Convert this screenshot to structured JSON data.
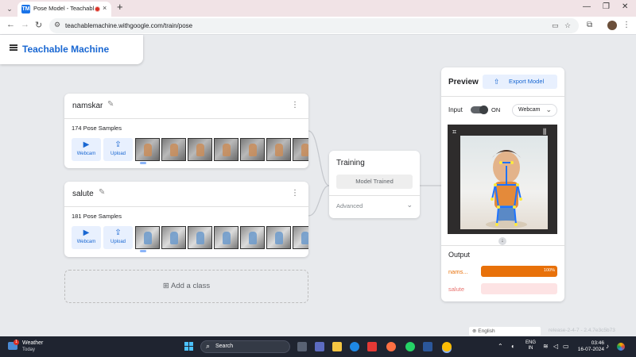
{
  "browser": {
    "tab_title": "Pose Model - Teachable Mac",
    "tab_close": "×",
    "new_tab": "+",
    "url": "teachablemachine.withgoogle.com/train/pose"
  },
  "app": {
    "title": "Teachable Machine"
  },
  "classes": [
    {
      "name": "namskar",
      "samples": "174 Pose Samples",
      "webcam_label": "Webcam",
      "upload_label": "Upload"
    },
    {
      "name": "salute",
      "samples": "181 Pose Samples",
      "webcam_label": "Webcam",
      "upload_label": "Upload"
    }
  ],
  "add_class": {
    "label": "Add a class"
  },
  "training": {
    "title": "Training",
    "button": "Model Trained",
    "advanced": "Advanced"
  },
  "preview": {
    "title": "Preview",
    "export_label": "Export Model",
    "input_label": "Input",
    "input_state": "ON",
    "source": "Webcam",
    "output_title": "Output",
    "outputs": [
      {
        "label": "nams...",
        "value": 100,
        "value_label": "100%",
        "color": "#e8710a",
        "track": "#fce8d6"
      },
      {
        "label": "salute",
        "value": 0,
        "value_label": "",
        "color": "#e8716d",
        "track": "#fde3e4"
      }
    ]
  },
  "footer": {
    "language": "English",
    "version": "release-2-4-7 - 2.4.7e3c5b73"
  },
  "taskbar": {
    "weather_badge": "1",
    "weather_title": "Weather",
    "weather_sub": "Today",
    "search_placeholder": "Search",
    "lang_top": "ENG",
    "lang_bottom": "IN",
    "time": "03:46",
    "date": "16-07-2024"
  },
  "colors": {
    "brand": "#1967d2",
    "accent_orange": "#e8710a",
    "accent_pink": "#e8716d"
  }
}
